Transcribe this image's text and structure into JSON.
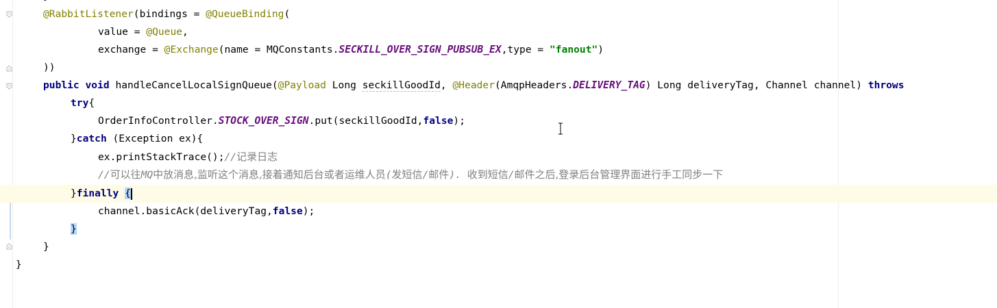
{
  "editor": {
    "lines": [
      {
        "segments": [
          {
            "t": "}",
            "c": "plain"
          }
        ]
      },
      {
        "segments": [
          {
            "t": "@RabbitListener",
            "c": "ann"
          },
          {
            "t": "(bindings = ",
            "c": "plain"
          },
          {
            "t": "@QueueBinding",
            "c": "ann"
          },
          {
            "t": "(",
            "c": "plain"
          }
        ]
      },
      {
        "segments": [
          {
            "t": "value = ",
            "c": "plain"
          },
          {
            "t": "@Queue",
            "c": "ann"
          },
          {
            "t": ",",
            "c": "plain"
          }
        ]
      },
      {
        "segments": [
          {
            "t": "exchange = ",
            "c": "plain"
          },
          {
            "t": "@Exchange",
            "c": "ann"
          },
          {
            "t": "(name = MQConstants.",
            "c": "plain"
          },
          {
            "t": "SECKILL_OVER_SIGN_PUBSUB_EX",
            "c": "const"
          },
          {
            "t": ",type = ",
            "c": "plain"
          },
          {
            "t": "\"fanout\"",
            "c": "str"
          },
          {
            "t": ")",
            "c": "plain"
          }
        ]
      },
      {
        "segments": [
          {
            "t": "))",
            "c": "plain"
          }
        ]
      },
      {
        "segments": [
          {
            "t": "public void ",
            "c": "kw"
          },
          {
            "t": "handleCancelLocalSignQueue(",
            "c": "plain"
          },
          {
            "t": "@Payload",
            "c": "ann"
          },
          {
            "t": " Long ",
            "c": "plain"
          },
          {
            "t": "seckillGoodId",
            "c": "squiggle"
          },
          {
            "t": ", ",
            "c": "plain"
          },
          {
            "t": "@Header",
            "c": "ann"
          },
          {
            "t": "(AmqpHeaders.",
            "c": "plain"
          },
          {
            "t": "DELIVERY_TAG",
            "c": "const"
          },
          {
            "t": ") Long deliveryTag, Channel channel) ",
            "c": "plain"
          },
          {
            "t": "throws",
            "c": "kw"
          }
        ]
      },
      {
        "segments": [
          {
            "t": "try",
            "c": "kw"
          },
          {
            "t": "{",
            "c": "plain"
          }
        ]
      },
      {
        "segments": [
          {
            "t": "OrderInfoController.",
            "c": "plain"
          },
          {
            "t": "STOCK_OVER_SIGN",
            "c": "const"
          },
          {
            "t": ".put(seckillGoodId,",
            "c": "plain"
          },
          {
            "t": "false",
            "c": "kw"
          },
          {
            "t": ");",
            "c": "plain"
          }
        ]
      },
      {
        "segments": [
          {
            "t": "}",
            "c": "plain"
          },
          {
            "t": "catch ",
            "c": "kw"
          },
          {
            "t": "(Exception ex){",
            "c": "plain"
          }
        ]
      },
      {
        "segments": [
          {
            "t": "ex.printStackTrace();",
            "c": "plain"
          },
          {
            "t": "//",
            "c": "cmt"
          },
          {
            "t": "记录日志",
            "c": "cmt-cjk"
          }
        ]
      },
      {
        "segments": [
          {
            "t": "//",
            "c": "cmt"
          },
          {
            "t": "可以往",
            "c": "cmt-cjk"
          },
          {
            "t": "MQ",
            "c": "cmt"
          },
          {
            "t": "中放消息,监听这个消息,接着通知后台或者运维人员",
            "c": "cmt-cjk"
          },
          {
            "t": "(",
            "c": "cmt"
          },
          {
            "t": "发短信",
            "c": "cmt-cjk"
          },
          {
            "t": "/",
            "c": "cmt"
          },
          {
            "t": "邮件",
            "c": "cmt-cjk"
          },
          {
            "t": "). ",
            "c": "cmt"
          },
          {
            "t": "收到短信",
            "c": "cmt-cjk"
          },
          {
            "t": "/",
            "c": "cmt"
          },
          {
            "t": "邮件之后,登录后台管理界面进行手工同步一下",
            "c": "cmt-cjk"
          }
        ]
      },
      {
        "segments": [
          {
            "t": "}",
            "c": "plain"
          },
          {
            "t": "finally ",
            "c": "kw"
          },
          {
            "t": "{",
            "c": "brace-hl"
          },
          {
            "t": "",
            "c": "caret"
          }
        ]
      },
      {
        "segments": [
          {
            "t": "channel.basicAck(deliveryTag,",
            "c": "plain"
          },
          {
            "t": "false",
            "c": "kw"
          },
          {
            "t": ");",
            "c": "plain"
          }
        ]
      },
      {
        "segments": [
          {
            "t": "}",
            "c": "brace-hl"
          }
        ]
      },
      {
        "segments": [
          {
            "t": "}",
            "c": "plain"
          }
        ]
      },
      {
        "segments": [
          {
            "t": "}",
            "c": "plain"
          }
        ]
      }
    ]
  }
}
